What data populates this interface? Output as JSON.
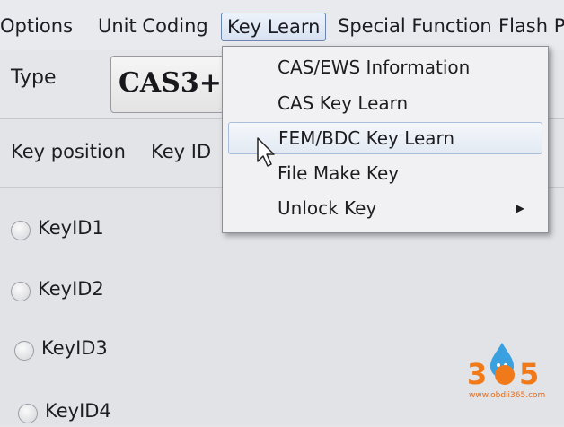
{
  "menubar": {
    "items": [
      {
        "label": "Options"
      },
      {
        "label": "Unit Coding"
      },
      {
        "label": "Key Learn"
      },
      {
        "label": "Special Function"
      },
      {
        "label": "Flash Pr"
      }
    ]
  },
  "type_row": {
    "label": "Type",
    "value": "CAS3+"
  },
  "key_header": {
    "position_label": "Key position",
    "id_label": "Key ID"
  },
  "keys": [
    {
      "label": "KeyID1"
    },
    {
      "label": "KeyID2"
    },
    {
      "label": "KeyID3"
    },
    {
      "label": "KeyID4"
    }
  ],
  "dropdown": {
    "items": [
      {
        "label": "CAS/EWS Information"
      },
      {
        "label": "CAS Key Learn"
      },
      {
        "label": "FEM/BDC Key Learn",
        "hovered": true
      },
      {
        "label": "File Make Key"
      },
      {
        "label": "Unlock Key",
        "has_submenu": true
      }
    ]
  },
  "watermark": {
    "logo_text": "365",
    "url": "www.obdii365.com"
  },
  "colors": {
    "accent_orange": "#f07a1a",
    "menu_highlight_border": "#6a86b0"
  }
}
